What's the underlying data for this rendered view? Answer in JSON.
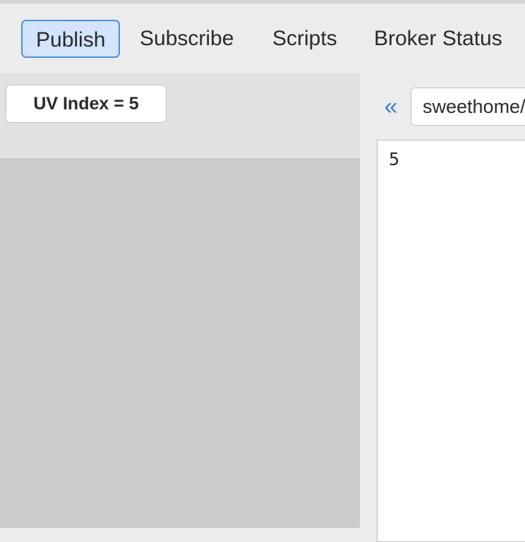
{
  "tabs": [
    {
      "label": "Publish",
      "active": true
    },
    {
      "label": "Subscribe",
      "active": false
    },
    {
      "label": "Scripts",
      "active": false
    },
    {
      "label": "Broker Status",
      "active": false
    }
  ],
  "left_panel": {
    "uv_button_label": "UV Index = 5"
  },
  "right_panel": {
    "collapse_icon": "double-chevron-left-icon",
    "collapse_glyph": "«",
    "topic_value": "sweethome/",
    "payload_text": "5"
  },
  "colors": {
    "accent": "#4a90e2",
    "active_tab_bg": "#d3e4fb"
  }
}
